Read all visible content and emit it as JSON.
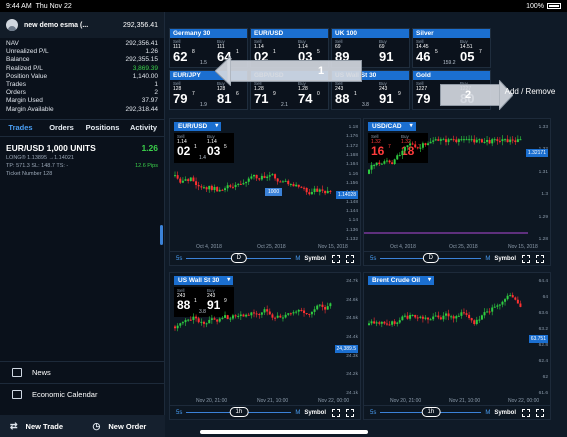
{
  "status": {
    "time": "9:44 AM",
    "date": "Thu Nov 22",
    "battery": "100%"
  },
  "account": {
    "name": "new demo esma (...",
    "value": "292,356.41",
    "rows": [
      {
        "label": "NAV",
        "value": "292,356.41"
      },
      {
        "label": "Unrealized P/L",
        "value": "1.26"
      },
      {
        "label": "Balance",
        "value": "292,355.15"
      },
      {
        "label": "Realized P/L",
        "value": "3,869.39"
      },
      {
        "label": "Position Value",
        "value": "1,140.00"
      },
      {
        "label": "Trades",
        "value": "1"
      },
      {
        "label": "Orders",
        "value": "2"
      },
      {
        "label": "Margin Used",
        "value": "37.97"
      },
      {
        "label": "Margin Available",
        "value": "292,318.44"
      }
    ]
  },
  "tabs": [
    "Trades",
    "Orders",
    "Positions",
    "Activity"
  ],
  "position": {
    "title": "EUR/USD  1,000 UNITS",
    "pl": "1.26",
    "line1": "LONG® 1.13895 →1.14021",
    "line2": "TP: 571.3   SL: 148.7   TS: -",
    "pips": "12.6 Pips",
    "ticket": "Ticket Number  128"
  },
  "menu": {
    "news": "News",
    "calendar": "Economic Calendar",
    "new_trade": "New Trade",
    "new_order": "New Order"
  },
  "quotes": [
    {
      "name": "Germany 30",
      "sell_sm": "111",
      "sell_big": "62",
      "sell_sup": "8",
      "buy_sm": "111",
      "buy_big": "64",
      "buy_sup": "1",
      "spread": "1.5"
    },
    {
      "name": "EUR/USD",
      "sell_sm": "1.14",
      "sell_big": "02",
      "sell_sup": "1",
      "buy_sm": "1.14",
      "buy_big": "03",
      "buy_sup": "5",
      "spread": ""
    },
    {
      "name": "UK 100",
      "sell_sm": "69",
      "sell_big": "89",
      "sell_sup": "",
      "buy_sm": "69",
      "buy_big": "91",
      "buy_sup": "",
      "spread": ""
    },
    {
      "name": "Silver",
      "sell_sm": "14.45",
      "sell_big": "46",
      "sell_sup": "5",
      "buy_sm": "14.51",
      "buy_big": "05",
      "buy_sup": "7",
      "spread": "159.2"
    },
    {
      "name": "EUR/JPY",
      "sell_sm": "128",
      "sell_big": "79",
      "sell_sup": "7",
      "buy_sm": "128",
      "buy_big": "81",
      "buy_sup": "6",
      "spread": "1.9"
    },
    {
      "name": "GBP/USD",
      "sell_sm": "1.28",
      "sell_big": "71",
      "sell_sup": "9",
      "buy_sm": "1.28",
      "buy_big": "74",
      "buy_sup": "0",
      "spread": "2.1"
    },
    {
      "name": "US Wall St 30",
      "sell_sm": "243",
      "sell_big": "88",
      "sell_sup": "1",
      "buy_sm": "243",
      "buy_big": "91",
      "buy_sup": "9",
      "spread": "3.8"
    },
    {
      "name": "Gold",
      "sell_sm": "1227",
      "sell_big": "79",
      "sell_sup": "",
      "buy_sm": "1227",
      "buy_big": "80",
      "buy_sup": "",
      "spread": ""
    }
  ],
  "callouts": {
    "one": "1",
    "two": "2"
  },
  "add_remove": "Add / Remove",
  "charts": [
    {
      "name": "EUR/USD",
      "sell_sm": "1.14",
      "sell_big": "02",
      "sell_sup": "1",
      "buy_sm": "1.14",
      "buy_big": "03",
      "buy_sup": "5",
      "spread": "1.4",
      "yticks": [
        "1.18",
        "1.176",
        "1.172",
        "1.168",
        "1.164",
        "1.16",
        "1.156",
        "1.152",
        "1.148",
        "1.144",
        "1.14",
        "1.136",
        "1.132"
      ],
      "xticks": [
        "Oct 4, 2018",
        "Oct 25, 2018",
        "Nov 15, 2018"
      ],
      "tag": "1.14028",
      "marker": "1000",
      "period": "D"
    },
    {
      "name": "USD/CAD",
      "sell_sm": "1.32",
      "sell_big": "16",
      "sell_sup": "7",
      "buy_sm": "1.32",
      "buy_big": "18",
      "buy_sup": "7",
      "spread": "",
      "yticks": [
        "1.33",
        "1.32",
        "1.31",
        "1.3",
        "1.29",
        "1.28"
      ],
      "xticks": [
        "Oct 4, 2018",
        "Oct 25, 2018",
        "Nov 15, 2018"
      ],
      "tag": "1.32171",
      "period": "D"
    },
    {
      "name": "US Wall St 30",
      "sell_sm": "243",
      "sell_big": "88",
      "sell_sup": "1",
      "buy_sm": "243",
      "buy_big": "91",
      "buy_sup": "9",
      "spread": "3.8",
      "yticks": [
        "24.7k",
        "24.6k",
        "24.5k",
        "24.4k",
        "24.3k",
        "24.2k",
        "24.1k"
      ],
      "xticks": [
        "Nov 20, 21:00",
        "Nov 21, 10:00",
        "Nov 22, 00:00"
      ],
      "tag": "24,389.5",
      "period": "1h"
    },
    {
      "name": "Brent Crude Oil",
      "yticks": [
        "64.4",
        "64",
        "63.6",
        "63.2",
        "62.8",
        "62.4",
        "62",
        "61.6"
      ],
      "xticks": [
        "Nov 20, 21:00",
        "Nov 21, 10:00",
        "Nov 22, 00:00"
      ],
      "tag": "63.751",
      "period": "1h"
    }
  ],
  "chart_footer": {
    "ss": "5s",
    "m": "M",
    "symbol": "Symbol"
  }
}
